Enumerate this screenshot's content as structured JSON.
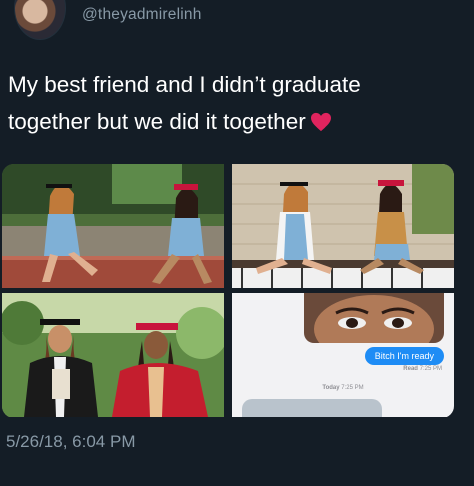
{
  "profile": {
    "handle": "@theyadmirelinh"
  },
  "tweet": {
    "text_line1": "My best friend and I didn’t graduate",
    "text_line2": "together but we did it together",
    "timestamp": "5/26/18, 6:04 PM"
  },
  "media": {
    "chat": {
      "message": "Bitch I'm ready",
      "read_label": "Read",
      "read_time": "7:25 PM",
      "today_label": "Today",
      "today_time": "7:25 PM"
    }
  },
  "colors": {
    "background": "#141d26",
    "text": "#ffffff",
    "muted": "#8899a6",
    "heart": "#e0245e",
    "imessage_blue": "#1e8cf5"
  },
  "icons": {
    "heart": "red-heart-emoji"
  }
}
